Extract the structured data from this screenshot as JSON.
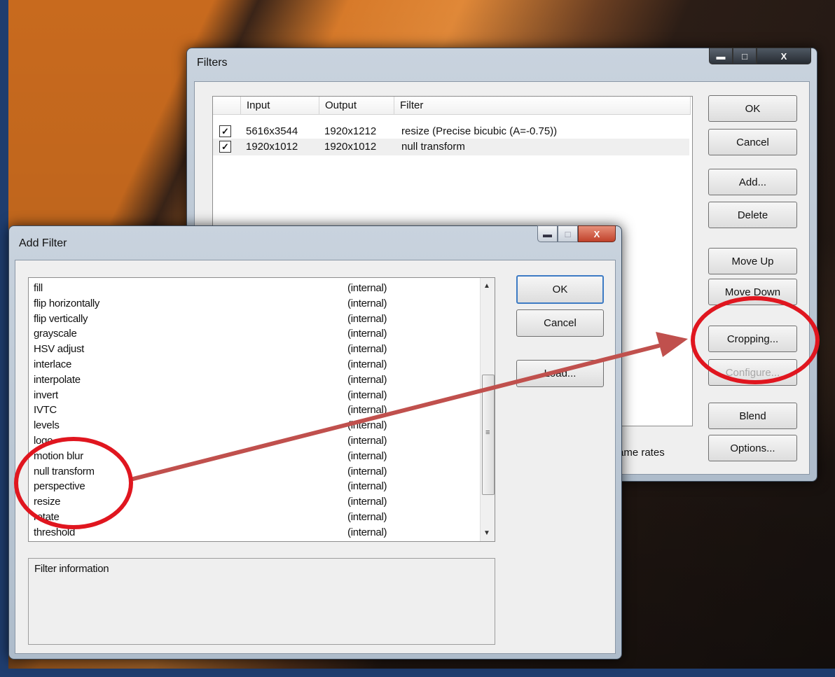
{
  "filters_window": {
    "title": "Filters",
    "columns": [
      "Input",
      "Output",
      "Filter"
    ],
    "rows": [
      {
        "checked": true,
        "input": "5616x3544",
        "output": "1920x1212",
        "filter": "resize (Precise bicubic (A=-0.75))"
      },
      {
        "checked": true,
        "input": "1920x1012",
        "output": "1920x1012",
        "filter": "null transform"
      }
    ],
    "buttons": {
      "ok": "OK",
      "cancel": "Cancel",
      "add": "Add...",
      "delete": "Delete",
      "move_up": "Move Up",
      "move_down": "Move Down",
      "cropping": "Cropping...",
      "configure": "Configure...",
      "blend": "Blend",
      "options": "Options..."
    },
    "frame_rates_partial": "ame rates",
    "caption": {
      "minimize": "▬",
      "maximize": "□",
      "close": "X"
    }
  },
  "add_filter_window": {
    "title": "Add Filter",
    "items": [
      {
        "name": "fill",
        "source": "(internal)"
      },
      {
        "name": "flip horizontally",
        "source": "(internal)"
      },
      {
        "name": "flip vertically",
        "source": "(internal)"
      },
      {
        "name": "grayscale",
        "source": "(internal)"
      },
      {
        "name": "HSV adjust",
        "source": "(internal)"
      },
      {
        "name": "interlace",
        "source": "(internal)"
      },
      {
        "name": "interpolate",
        "source": "(internal)"
      },
      {
        "name": "invert",
        "source": "(internal)"
      },
      {
        "name": "IVTC",
        "source": "(internal)"
      },
      {
        "name": "levels",
        "source": "(internal)"
      },
      {
        "name": "logo",
        "source": "(internal)"
      },
      {
        "name": "motion blur",
        "source": "(internal)"
      },
      {
        "name": "null transform",
        "source": "(internal)"
      },
      {
        "name": "perspective",
        "source": "(internal)"
      },
      {
        "name": "resize",
        "source": "(internal)"
      },
      {
        "name": "rotate",
        "source": "(internal)"
      },
      {
        "name": "threshold",
        "source": "(internal)"
      }
    ],
    "buttons": {
      "ok": "OK",
      "cancel": "Cancel",
      "load": "Load..."
    },
    "info_label": "Filter information",
    "caption": {
      "minimize": "▬",
      "maximize": "□",
      "close": "X"
    }
  },
  "annotation": {
    "color": "#e0161f",
    "arrow_color": "#c0504d"
  }
}
